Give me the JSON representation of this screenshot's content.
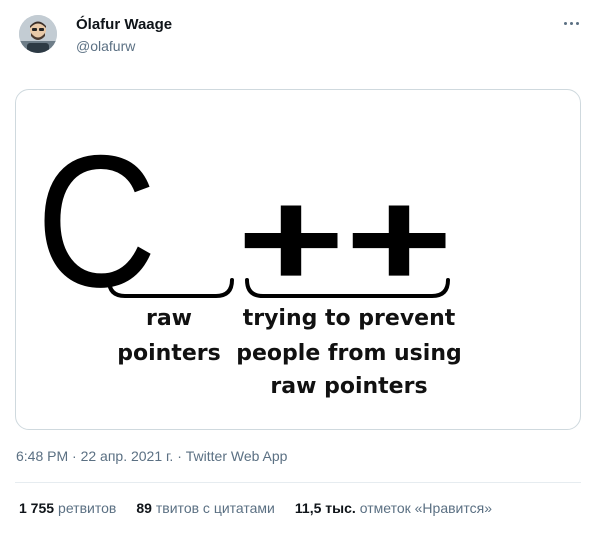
{
  "author": {
    "display_name": "Ólafur Waage",
    "handle": "@olafurw",
    "avatar_icon": "avatar-illustration-icon"
  },
  "more_icon": "more-dots-icon",
  "image": {
    "big_c": "C",
    "plus_plus": "++",
    "left_caption": [
      "raw",
      "pointers"
    ],
    "right_caption": [
      "trying to prevent",
      "people from using",
      "raw pointers"
    ]
  },
  "meta": {
    "time": "6:48 PM",
    "separator1": " · ",
    "date": "22 апр. 2021 г.",
    "separator2": " · ",
    "source": "Twitter Web App"
  },
  "stats": {
    "retweets_count": "1 755",
    "retweets_label": "ретвитов",
    "quotes_count": "89",
    "quotes_label": "твитов с цитатами",
    "likes_count": "11,5 тыс.",
    "likes_label": "отметок «Нравится»"
  },
  "colors": {
    "text_primary": "#0f1419",
    "text_secondary": "#5b7083",
    "border": "#cfd9de"
  }
}
